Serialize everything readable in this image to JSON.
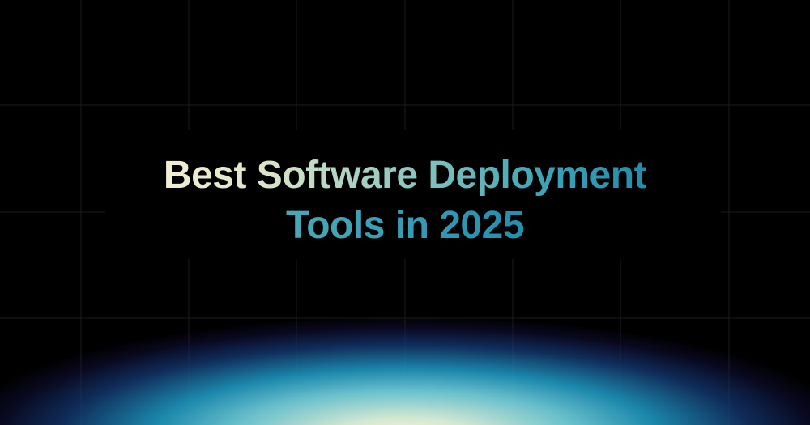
{
  "title": {
    "line_1": "Best Software Deployment",
    "line_2": "Tools in 2025"
  },
  "colors": {
    "background": "#000000",
    "title_start": "#f7efd6",
    "title_end": "#1b87aa",
    "glow_core": "#faf4d6",
    "glow_mid": "#1e96be",
    "glow_edge": "#140a46"
  }
}
